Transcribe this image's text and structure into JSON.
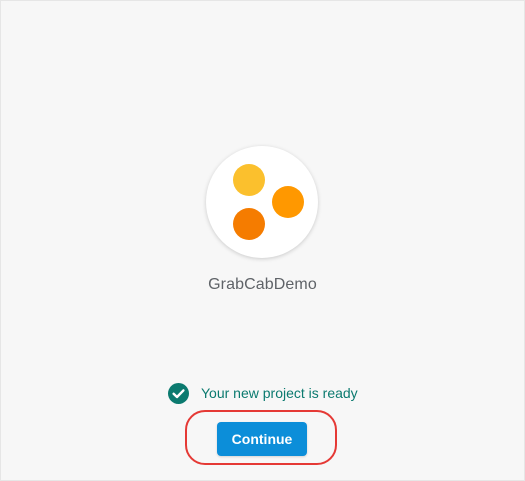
{
  "project": {
    "name": "GrabCabDemo",
    "logo_colors": [
      "#fbc02d",
      "#ff9800",
      "#f57c00"
    ]
  },
  "status": {
    "text": "Your new project is ready",
    "icon": "check-circle-icon",
    "color": "#0b7a6f"
  },
  "actions": {
    "continue_label": "Continue",
    "accent": "#0c8ed9",
    "highlight_color": "#e53935"
  }
}
